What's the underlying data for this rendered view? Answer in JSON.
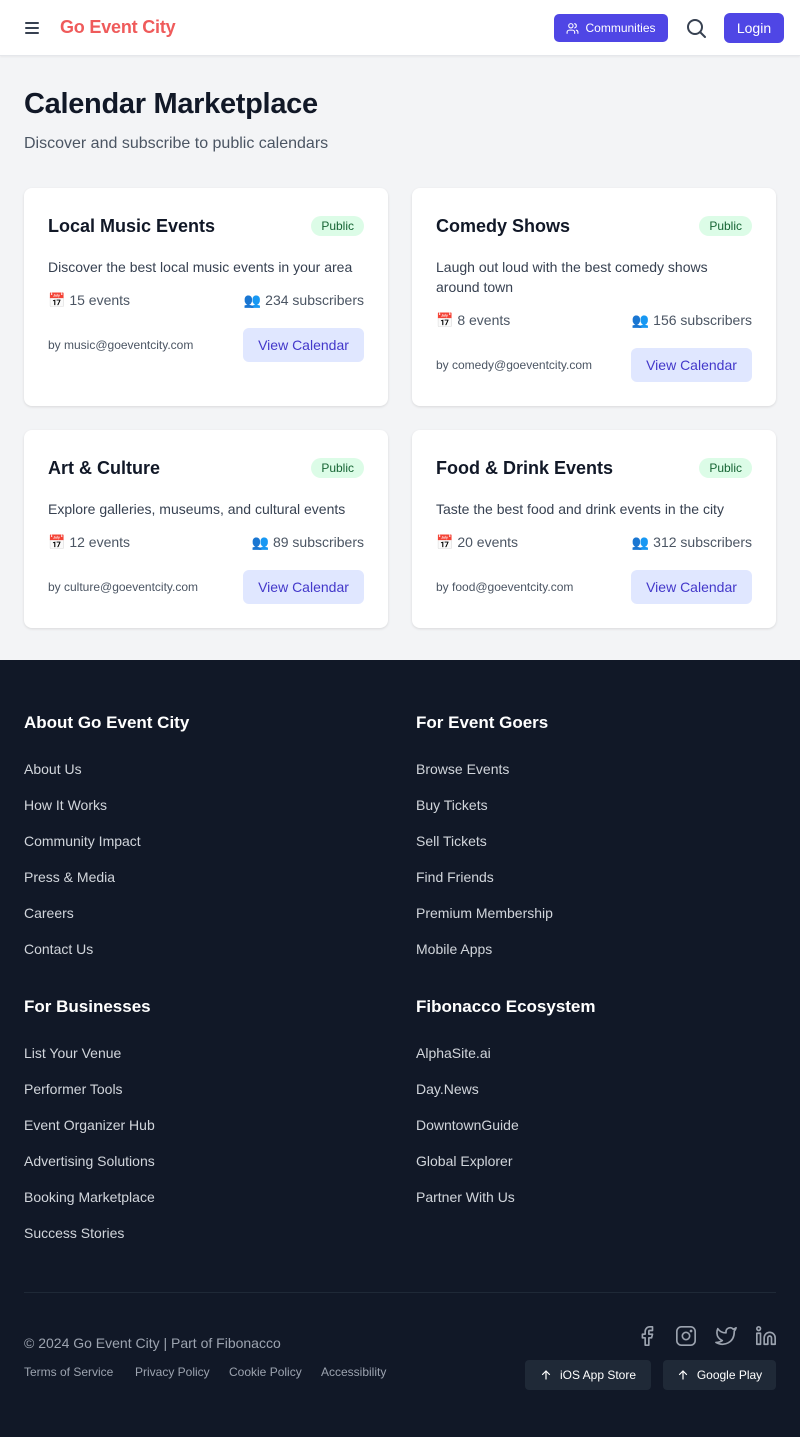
{
  "header": {
    "brand": "Go Event City",
    "communities_label": "Communities",
    "login_label": "Login"
  },
  "main": {
    "title": "Calendar Marketplace",
    "subtitle": "Discover and subscribe to public calendars"
  },
  "calendars": [
    {
      "title": "Local Music Events",
      "badge": "Public",
      "description": "Discover the best local music events in your area",
      "events": "📅 15 events",
      "subscribers": "👥 234 subscribers",
      "owner": "by music@goeventcity.com",
      "action": "View Calendar"
    },
    {
      "title": "Comedy Shows",
      "badge": "Public",
      "description": "Laugh out loud with the best comedy shows around town",
      "events": "📅 8 events",
      "subscribers": "👥 156 subscribers",
      "owner": "by comedy@goeventcity.com",
      "action": "View Calendar"
    },
    {
      "title": "Art & Culture",
      "badge": "Public",
      "description": "Explore galleries, museums, and cultural events",
      "events": "📅 12 events",
      "subscribers": "👥 89 subscribers",
      "owner": "by culture@goeventcity.com",
      "action": "View Calendar"
    },
    {
      "title": "Food & Drink Events",
      "badge": "Public",
      "description": "Taste the best food and drink events in the city",
      "events": "📅 20 events",
      "subscribers": "👥 312 subscribers",
      "owner": "by food@goeventcity.com",
      "action": "View Calendar"
    }
  ],
  "footer": {
    "columns": [
      {
        "heading": "About Go Event City",
        "links": [
          "About Us",
          "How It Works",
          "Community Impact",
          "Press & Media",
          "Careers",
          "Contact Us"
        ]
      },
      {
        "heading": "For Event Goers",
        "links": [
          "Browse Events",
          "Buy Tickets",
          "Sell Tickets",
          "Find Friends",
          "Premium Membership",
          "Mobile Apps"
        ]
      },
      {
        "heading": "For Businesses",
        "links": [
          "List Your Venue",
          "Performer Tools",
          "Event Organizer Hub",
          "Advertising Solutions",
          "Booking Marketplace",
          "Success Stories"
        ]
      },
      {
        "heading": "Fibonacco Ecosystem",
        "links": [
          "AlphaSite.ai",
          "Day.News",
          "DowntownGuide",
          "Global Explorer",
          "Partner With Us"
        ]
      }
    ],
    "copyright": "© 2024 Go Event City | Part of Fibonacco",
    "legal": [
      "Terms of Service",
      "Privacy Policy",
      "Cookie Policy",
      "Accessibility"
    ],
    "social_icons": [
      "facebook-icon",
      "instagram-icon",
      "twitter-icon",
      "linkedin-icon"
    ],
    "ios_store": "iOS App Store",
    "google_play": "Google Play"
  },
  "colors": {
    "brand": "#ef5b5b",
    "primary": "#4f46e5",
    "footer_bg": "#111827",
    "badge_bg": "#dcfce7",
    "badge_text": "#166534"
  }
}
